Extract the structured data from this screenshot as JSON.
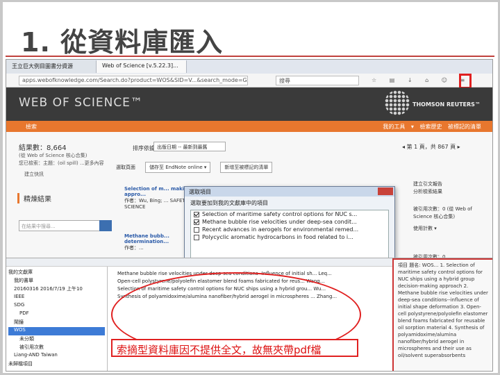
{
  "slide": {
    "title": "1. 從資料庫匯入"
  },
  "browser": {
    "tabs": [
      "王立巨大例目圖書分資源",
      "Web of Science [v.5.22.3]..."
    ],
    "url": "apps.webofknowledge.com/Search.do?product=WOS&SID=V...&search_mode=G...",
    "search_placeholder": "搜尋"
  },
  "wos": {
    "logo": "WEB OF SCIENCE™",
    "publisher": "THOMSON REUTERS™",
    "bar_left": "檢索",
    "bar_right": "我的工具 ▾  檢索歷史  被標記的清單"
  },
  "results": {
    "count_label": "結果數：8,664",
    "count_sub": "(從 Web of Science 核心合集)",
    "topic": "您已檢索：主題：(oil spill) ...更多內容",
    "alert": "建立快訊",
    "sort_label": "排序依據：",
    "sort_value": "出版日期 -- 最新到最舊",
    "pager": "◂  第 1 頁，共 867 頁  ▸",
    "actions": [
      "選取頁面",
      "儲存至 EndNote online ▾",
      "新增至被標記的清單"
    ],
    "refine": "精煉結果",
    "refine_placeholder": "在結果中搜尋...",
    "records": [
      {
        "title": "Selection of m... making appro...",
        "meta": "作者：Wu, Bing; ... SAFETY SCIENCE"
      },
      {
        "title": "Methane bubb... determination...",
        "meta": "作者：..."
      }
    ],
    "sidebar": [
      "被引用次數：0 (從 Web of Science 核心合集)",
      "使用計數 ▾",
      "被引用次數：0"
    ],
    "right_links": [
      "建立引文報告",
      "分析檢索結果"
    ]
  },
  "dialog": {
    "title": "選取項目",
    "subtitle": "選取要加到我的文獻庫中的項目",
    "items": [
      {
        "label": "Selection of maritime safety control options for NUC s...",
        "checked": true
      },
      {
        "label": "Methane bubble rise velocities under deep-sea condit...",
        "checked": true
      },
      {
        "label": "Recent advances in aerogels for environmental remed...",
        "checked": false
      },
      {
        "label": "Polycyclic aromatic hydrocarbons in food related to i...",
        "checked": false
      }
    ]
  },
  "zotero": {
    "tree": [
      "我的文獻庫",
      "我的書單",
      "20160316 2016/7/19 上午10",
      "IEEE",
      "SDG",
      "PDF",
      "鬧鐘",
      "WOS",
      "未分類",
      "被引用次數",
      "Liang-AND Taiwan",
      "未歸檔項目"
    ],
    "items": [
      "Methane bubble rise velocities under deep-sea conditions--Influence of initial sh... Leq...",
      "Open-cell polystyrene/polyolefin elastomer blend foams fabricated for reus... Wang...",
      "Selection of maritime safety control options for NUC ships using a hybrid grou... Wu...",
      "Synthesis of polyamidoxime/alumina nanofiber/hybrid aerogel in microspheres ... Zhang..."
    ],
    "right_panel": "項目 題名: WOS... 1. Selection of maritime safety control options for NUC ships using a hybrid group decision-making approach  2. Methane bubble rise velocities under deep-sea conditions--influence of initial shape deformation  3. Open-cell polystyrene/polyolefin elastomer blend foams fabricated for reusable oil sorption material  4. Synthesis of polyamidoxime/alumina nanofiber/hybrid aerogel in microspheres and their use as oil/solvent superabsorbents"
  },
  "note": "索摘型資料庫因不提供全文，故無夾帶pdf檔"
}
